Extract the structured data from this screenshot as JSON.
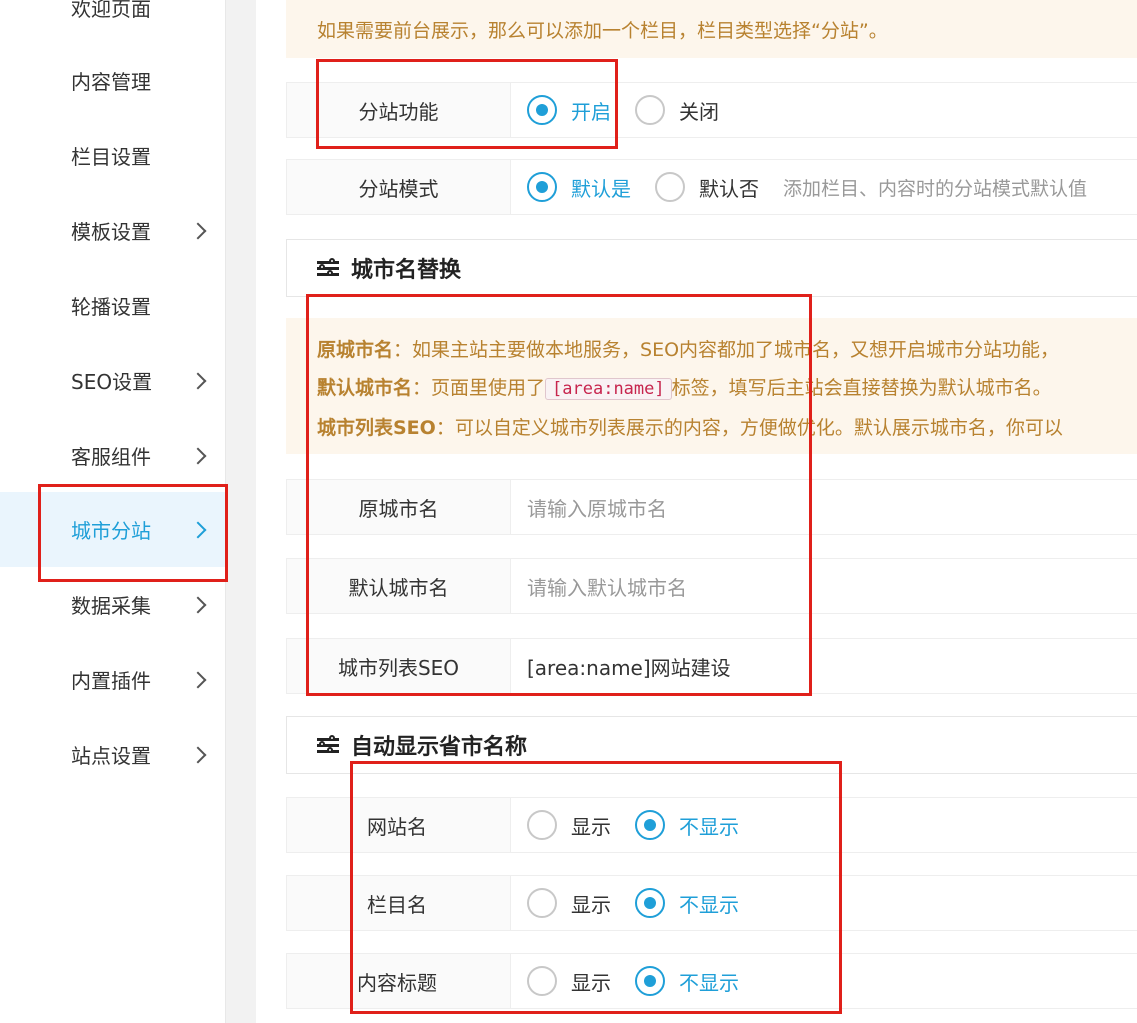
{
  "sidebar": {
    "items": [
      {
        "label": "欢迎页面",
        "has_arrow": false
      },
      {
        "label": "内容管理",
        "has_arrow": false
      },
      {
        "label": "栏目设置",
        "has_arrow": false
      },
      {
        "label": "模板设置",
        "has_arrow": true
      },
      {
        "label": "轮播设置",
        "has_arrow": false
      },
      {
        "label": "SEO设置",
        "has_arrow": true
      },
      {
        "label": "客服组件",
        "has_arrow": true
      },
      {
        "label": "城市分站",
        "has_arrow": true,
        "active": true
      },
      {
        "label": "数据采集",
        "has_arrow": true
      },
      {
        "label": "内置插件",
        "has_arrow": true
      },
      {
        "label": "站点设置",
        "has_arrow": true
      }
    ]
  },
  "top_notice": {
    "line1": "如果需要前台展示，那么可以添加一个栏目，栏目类型选择“分站”。"
  },
  "substation": {
    "function": {
      "label": "分站功能",
      "options": [
        "开启",
        "关闭"
      ],
      "selected": "开启"
    },
    "mode": {
      "label": "分站模式",
      "options": [
        "默认是",
        "默认否"
      ],
      "selected": "默认是",
      "hint": "添加栏目、内容时的分站模式默认值"
    }
  },
  "city_replace": {
    "title": "城市名替换",
    "notice": {
      "l1_label": "原城市名",
      "l1_text": "：如果主站主要做本地服务，SEO内容都加了城市名，又想开启城市分站功能，",
      "l2_label": "默认城市名",
      "l2_pre": "：页面里使用了",
      "l2_code": "[area:name]",
      "l2_post": "标签，填写后主站会直接替换为默认城市名。",
      "l3_label": "城市列表SEO",
      "l3_text": "：可以自定义城市列表展示的内容，方便做优化。默认展示城市名，你可以"
    },
    "fields": {
      "original": {
        "label": "原城市名",
        "placeholder": "请输入原城市名"
      },
      "default": {
        "label": "默认城市名",
        "placeholder": "请输入默认城市名"
      },
      "seo": {
        "label": "城市列表SEO",
        "value": "[area:name]网站建设"
      }
    }
  },
  "auto_display": {
    "title": "自动显示省市名称",
    "rows": [
      {
        "label": "网站名",
        "options": [
          "显示",
          "不显示"
        ],
        "selected": "不显示"
      },
      {
        "label": "栏目名",
        "options": [
          "显示",
          "不显示"
        ],
        "selected": "不显示"
      },
      {
        "label": "内容标题",
        "options": [
          "显示",
          "不显示"
        ],
        "selected": "不显示"
      }
    ]
  },
  "colors": {
    "accent": "#1f9fd8",
    "highlight_box": "#e0201a",
    "notice_text": "#b88230",
    "notice_bg": "#fdf6ec"
  }
}
